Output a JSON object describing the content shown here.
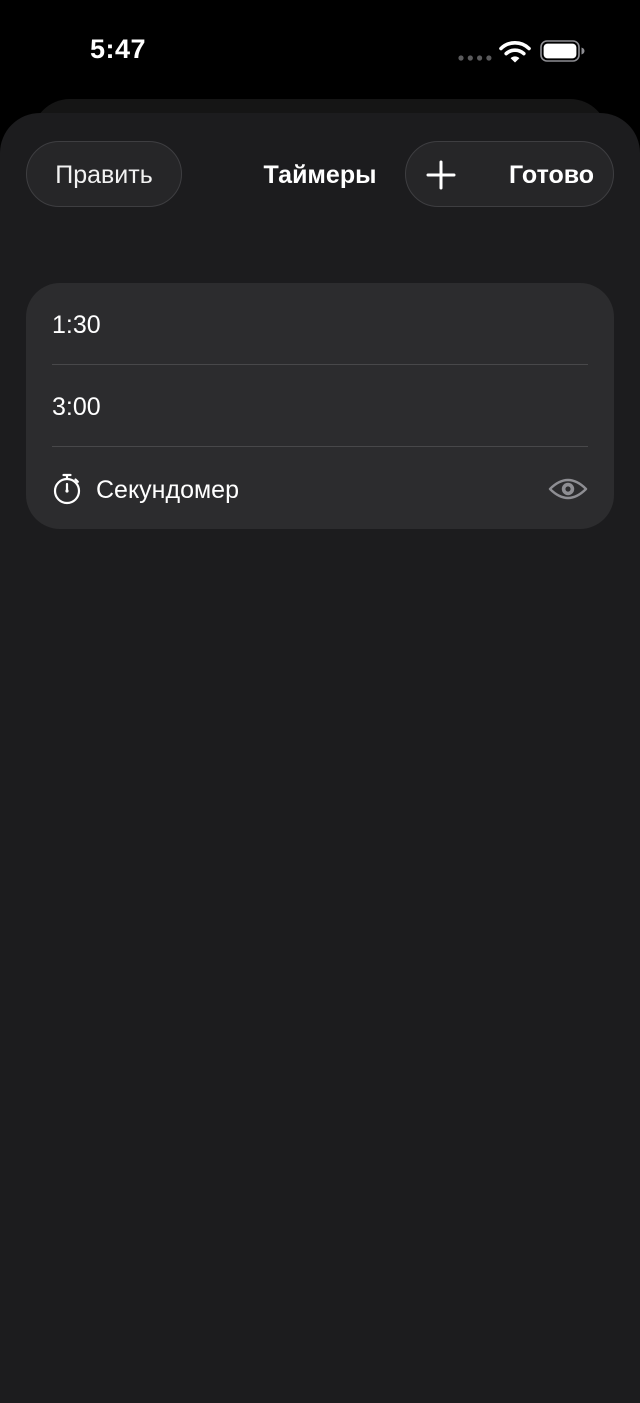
{
  "status_bar": {
    "time": "5:47",
    "icons": [
      "signal-dots-icon",
      "wifi-icon",
      "battery-icon"
    ]
  },
  "header": {
    "edit_label": "Править",
    "title": "Таймеры",
    "add_icon": "plus-icon",
    "done_label": "Готово"
  },
  "list": {
    "items": [
      {
        "label": "1:30"
      },
      {
        "label": "3:00"
      },
      {
        "label": "Секундомер",
        "icon": "stopwatch-icon",
        "trailing_icon": "eye-icon"
      }
    ]
  },
  "colors": {
    "background": "#000000",
    "sheet": "#1c1c1e",
    "card": "#2c2c2e",
    "divider": "#48484a",
    "text": "#ffffff",
    "secondary_icon": "#8e8e93"
  }
}
